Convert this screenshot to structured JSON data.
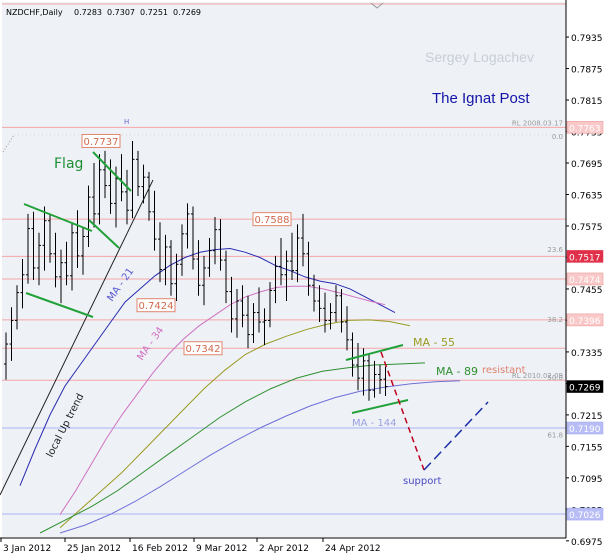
{
  "header": {
    "symbol_line": "NZDCHF,Daily",
    "ohlc": [
      "0.7283",
      "0.7307",
      "0.7251",
      "0.7269"
    ]
  },
  "watermark": "Sergey Logachev",
  "brand": "The Ignat Post",
  "colors": {
    "plot_bg": "#eef2f7",
    "bar": "#000000",
    "level_line": "#f4a6a6",
    "blue_line": "#aab0f4",
    "flag": "#22a13a",
    "forecast_red": "#c0001c",
    "forecast_blue": "#1a2ea8",
    "ma21": "#2a2ab0",
    "ma34": "#d070c0",
    "ma55": "#9a9a22",
    "ma89": "#2f8f2f",
    "ma144": "#6f6fd9"
  },
  "annotations": {
    "flag": "Flag",
    "local_trend": "local Up trend",
    "resistant": "resistant",
    "support": "support",
    "ma21": "MA - 21",
    "ma34": "MA - 34",
    "ma55": "MA - 55",
    "ma89": "MA - 89",
    "ma144": "MA - 144",
    "marker_h": "H"
  },
  "price_labels": [
    {
      "text": "0.7737",
      "value": 0.7737
    },
    {
      "text": "0.7588",
      "value": 0.7588
    },
    {
      "text": "0.7424",
      "value": 0.7424
    },
    {
      "text": "0.7342",
      "value": 0.7342
    }
  ],
  "level_notes": [
    {
      "text": "RL 2008.03.17",
      "value": 0.7763
    },
    {
      "text": "RL 2010.02.09",
      "value": 0.7281
    },
    {
      "text": "0.0",
      "value": 0.7737
    },
    {
      "text": "23.6",
      "value": 0.7522
    },
    {
      "text": "38.2",
      "value": 0.7388
    },
    {
      "text": "50.0",
      "value": 0.7278
    },
    {
      "text": "61.8",
      "value": 0.7168
    }
  ],
  "chart_data": {
    "type": "ohlc",
    "ylim": [
      0.6988,
      0.7998
    ],
    "y_ticks": [
      "0.7935",
      "0.7875",
      "0.7815",
      "0.7755",
      "0.7695",
      "0.7635",
      "0.7575",
      "0.7515",
      "0.7455",
      "0.7395",
      "0.7335",
      "0.7275",
      "0.7215",
      "0.7155",
      "0.7095",
      "0.7035",
      "0.6975"
    ],
    "x_ticks": [
      "3 Jan 2012",
      "25 Jan 2012",
      "16 Feb 2012",
      "9 Mar 2012",
      "2 Apr 2012",
      "24 Apr 2012"
    ],
    "price_box_labels": [
      {
        "text": "0.7763",
        "value": 0.7763,
        "style": "pink"
      },
      {
        "text": "0.7517",
        "value": 0.7517,
        "style": "red"
      },
      {
        "text": "0.7474",
        "value": 0.7474,
        "style": "pink"
      },
      {
        "text": "0.7396",
        "value": 0.7396,
        "style": "pink"
      },
      {
        "text": "0.7269",
        "value": 0.7269,
        "style": "black"
      },
      {
        "text": "0.7190",
        "value": 0.719,
        "style": "blue"
      },
      {
        "text": "0.7026",
        "value": 0.7026,
        "style": "blue"
      }
    ],
    "horizontal_levels": [
      {
        "value": 0.7998,
        "color": "pink"
      },
      {
        "value": 0.7763,
        "color": "pink"
      },
      {
        "value": 0.7588,
        "color": "pink"
      },
      {
        "value": 0.7517,
        "color": "pink"
      },
      {
        "value": 0.7474,
        "color": "pink"
      },
      {
        "value": 0.7396,
        "color": "pink"
      },
      {
        "value": 0.7342,
        "color": "pink"
      },
      {
        "value": 0.7281,
        "color": "pink"
      },
      {
        "value": 0.719,
        "color": "blue"
      },
      {
        "value": 0.7026,
        "color": "blue"
      }
    ],
    "bars": [
      {
        "o": 0.7312,
        "h": 0.7372,
        "l": 0.7282,
        "c": 0.735
      },
      {
        "o": 0.735,
        "h": 0.742,
        "l": 0.7318,
        "c": 0.7395
      },
      {
        "o": 0.7395,
        "h": 0.7462,
        "l": 0.7378,
        "c": 0.7448
      },
      {
        "o": 0.7448,
        "h": 0.7512,
        "l": 0.7418,
        "c": 0.7482
      },
      {
        "o": 0.7482,
        "h": 0.7598,
        "l": 0.7465,
        "c": 0.757
      },
      {
        "o": 0.757,
        "h": 0.7602,
        "l": 0.7472,
        "c": 0.7495
      },
      {
        "o": 0.7495,
        "h": 0.7562,
        "l": 0.7462,
        "c": 0.7538
      },
      {
        "o": 0.7538,
        "h": 0.7612,
        "l": 0.749,
        "c": 0.7585
      },
      {
        "o": 0.7585,
        "h": 0.7598,
        "l": 0.7505,
        "c": 0.7522
      },
      {
        "o": 0.7522,
        "h": 0.7562,
        "l": 0.7458,
        "c": 0.7478
      },
      {
        "o": 0.7478,
        "h": 0.753,
        "l": 0.7428,
        "c": 0.7505
      },
      {
        "o": 0.7505,
        "h": 0.7545,
        "l": 0.7462,
        "c": 0.748
      },
      {
        "o": 0.748,
        "h": 0.7582,
        "l": 0.7452,
        "c": 0.7562
      },
      {
        "o": 0.7562,
        "h": 0.7605,
        "l": 0.7495,
        "c": 0.7518
      },
      {
        "o": 0.7518,
        "h": 0.7572,
        "l": 0.7482,
        "c": 0.7555
      },
      {
        "o": 0.7555,
        "h": 0.7652,
        "l": 0.7535,
        "c": 0.763
      },
      {
        "o": 0.763,
        "h": 0.7695,
        "l": 0.7572,
        "c": 0.7598
      },
      {
        "o": 0.7598,
        "h": 0.7712,
        "l": 0.7578,
        "c": 0.7682
      },
      {
        "o": 0.7682,
        "h": 0.7718,
        "l": 0.7628,
        "c": 0.7652
      },
      {
        "o": 0.7652,
        "h": 0.7702,
        "l": 0.7598,
        "c": 0.7618
      },
      {
        "o": 0.7618,
        "h": 0.7688,
        "l": 0.7572,
        "c": 0.7665
      },
      {
        "o": 0.7665,
        "h": 0.7712,
        "l": 0.7622,
        "c": 0.764
      },
      {
        "o": 0.764,
        "h": 0.7682,
        "l": 0.7578,
        "c": 0.7605
      },
      {
        "o": 0.7605,
        "h": 0.7737,
        "l": 0.759,
        "c": 0.7702
      },
      {
        "o": 0.7702,
        "h": 0.7718,
        "l": 0.7632,
        "c": 0.765
      },
      {
        "o": 0.765,
        "h": 0.7692,
        "l": 0.7618,
        "c": 0.7668
      },
      {
        "o": 0.7668,
        "h": 0.7678,
        "l": 0.7585,
        "c": 0.7602
      },
      {
        "o": 0.7602,
        "h": 0.7642,
        "l": 0.7528,
        "c": 0.755
      },
      {
        "o": 0.755,
        "h": 0.7582,
        "l": 0.7468,
        "c": 0.7492
      },
      {
        "o": 0.7492,
        "h": 0.7558,
        "l": 0.7462,
        "c": 0.7535
      },
      {
        "o": 0.7535,
        "h": 0.7548,
        "l": 0.7442,
        "c": 0.7465
      },
      {
        "o": 0.7465,
        "h": 0.7522,
        "l": 0.7432,
        "c": 0.7502
      },
      {
        "o": 0.7502,
        "h": 0.7578,
        "l": 0.748,
        "c": 0.756
      },
      {
        "o": 0.756,
        "h": 0.7618,
        "l": 0.7532,
        "c": 0.7598
      },
      {
        "o": 0.7598,
        "h": 0.7612,
        "l": 0.7492,
        "c": 0.7512
      },
      {
        "o": 0.7512,
        "h": 0.7548,
        "l": 0.7442,
        "c": 0.7462
      },
      {
        "o": 0.7462,
        "h": 0.7518,
        "l": 0.7424,
        "c": 0.7495
      },
      {
        "o": 0.7495,
        "h": 0.7552,
        "l": 0.7478,
        "c": 0.7528
      },
      {
        "o": 0.7528,
        "h": 0.7592,
        "l": 0.7502,
        "c": 0.7568
      },
      {
        "o": 0.7568,
        "h": 0.7588,
        "l": 0.749,
        "c": 0.751
      },
      {
        "o": 0.751,
        "h": 0.7528,
        "l": 0.7428,
        "c": 0.745
      },
      {
        "o": 0.745,
        "h": 0.7478,
        "l": 0.7372,
        "c": 0.7398
      },
      {
        "o": 0.7398,
        "h": 0.7455,
        "l": 0.7362,
        "c": 0.7432
      },
      {
        "o": 0.7432,
        "h": 0.7462,
        "l": 0.7382,
        "c": 0.7405
      },
      {
        "o": 0.7405,
        "h": 0.7442,
        "l": 0.7342,
        "c": 0.7368
      },
      {
        "o": 0.7368,
        "h": 0.7428,
        "l": 0.7352,
        "c": 0.741
      },
      {
        "o": 0.741,
        "h": 0.7458,
        "l": 0.7372,
        "c": 0.7392
      },
      {
        "o": 0.7392,
        "h": 0.7418,
        "l": 0.7348,
        "c": 0.7395
      },
      {
        "o": 0.7395,
        "h": 0.7468,
        "l": 0.7382,
        "c": 0.7452
      },
      {
        "o": 0.7452,
        "h": 0.7518,
        "l": 0.7428,
        "c": 0.7498
      },
      {
        "o": 0.7498,
        "h": 0.7552,
        "l": 0.7462,
        "c": 0.7482
      },
      {
        "o": 0.7482,
        "h": 0.7528,
        "l": 0.7432,
        "c": 0.7508
      },
      {
        "o": 0.7508,
        "h": 0.7562,
        "l": 0.7472,
        "c": 0.749
      },
      {
        "o": 0.749,
        "h": 0.7578,
        "l": 0.7468,
        "c": 0.7552
      },
      {
        "o": 0.7552,
        "h": 0.7598,
        "l": 0.7498,
        "c": 0.7522
      },
      {
        "o": 0.7522,
        "h": 0.7545,
        "l": 0.7442,
        "c": 0.7462
      },
      {
        "o": 0.7462,
        "h": 0.7482,
        "l": 0.7412,
        "c": 0.7432
      },
      {
        "o": 0.7432,
        "h": 0.7462,
        "l": 0.7392,
        "c": 0.7418
      },
      {
        "o": 0.7418,
        "h": 0.7448,
        "l": 0.7372,
        "c": 0.7395
      },
      {
        "o": 0.7395,
        "h": 0.7428,
        "l": 0.7378,
        "c": 0.741
      },
      {
        "o": 0.741,
        "h": 0.7462,
        "l": 0.7392,
        "c": 0.7442
      },
      {
        "o": 0.7442,
        "h": 0.7455,
        "l": 0.7372,
        "c": 0.7392
      },
      {
        "o": 0.7392,
        "h": 0.7422,
        "l": 0.7338,
        "c": 0.7358
      },
      {
        "o": 0.7358,
        "h": 0.7372,
        "l": 0.7288,
        "c": 0.731
      },
      {
        "o": 0.731,
        "h": 0.7352,
        "l": 0.7262,
        "c": 0.7285
      },
      {
        "o": 0.7285,
        "h": 0.7342,
        "l": 0.7252,
        "c": 0.7318
      },
      {
        "o": 0.7318,
        "h": 0.733,
        "l": 0.7242,
        "c": 0.7262
      },
      {
        "o": 0.7262,
        "h": 0.7318,
        "l": 0.7248,
        "c": 0.7292
      },
      {
        "o": 0.7292,
        "h": 0.731,
        "l": 0.7255,
        "c": 0.7282
      },
      {
        "o": 0.7283,
        "h": 0.7307,
        "l": 0.7251,
        "c": 0.7269
      }
    ],
    "moving_averages": [
      {
        "name": "MA - 21",
        "values": [
          0.708,
          0.715,
          0.7215,
          0.727,
          0.731,
          0.735,
          0.739,
          0.743,
          0.7455,
          0.748,
          0.75,
          0.7515,
          0.7525,
          0.753,
          0.7532,
          0.7525,
          0.7515,
          0.75,
          0.749,
          0.7478,
          0.747,
          0.7465,
          0.7455,
          0.744,
          0.7425,
          0.741
        ]
      },
      {
        "name": "MA - 34",
        "values": [
          0.7025,
          0.707,
          0.712,
          0.717,
          0.7215,
          0.7255,
          0.7295,
          0.733,
          0.736,
          0.7385,
          0.7405,
          0.7425,
          0.744,
          0.745,
          0.7458,
          0.746,
          0.746,
          0.7455,
          0.7448,
          0.744,
          0.7432,
          0.7425
        ]
      },
      {
        "name": "MA - 55",
        "values": [
          0.7,
          0.7035,
          0.707,
          0.7105,
          0.7145,
          0.7185,
          0.7225,
          0.7265,
          0.73,
          0.733,
          0.735,
          0.7365,
          0.7378,
          0.7388,
          0.7395,
          0.7396,
          0.7393,
          0.7385
        ]
      },
      {
        "name": "MA - 89",
        "values": [
          0.699,
          0.7015,
          0.704,
          0.707,
          0.7105,
          0.714,
          0.7175,
          0.721,
          0.724,
          0.7265,
          0.7285,
          0.7298,
          0.7305,
          0.731,
          0.7312,
          0.7314
        ]
      },
      {
        "name": "MA - 144",
        "values": [
          0.699,
          0.7005,
          0.7025,
          0.705,
          0.7078,
          0.7108,
          0.7138,
          0.7165,
          0.719,
          0.7212,
          0.7232,
          0.7248,
          0.726,
          0.7268,
          0.7274,
          0.7278,
          0.728
        ]
      }
    ]
  }
}
